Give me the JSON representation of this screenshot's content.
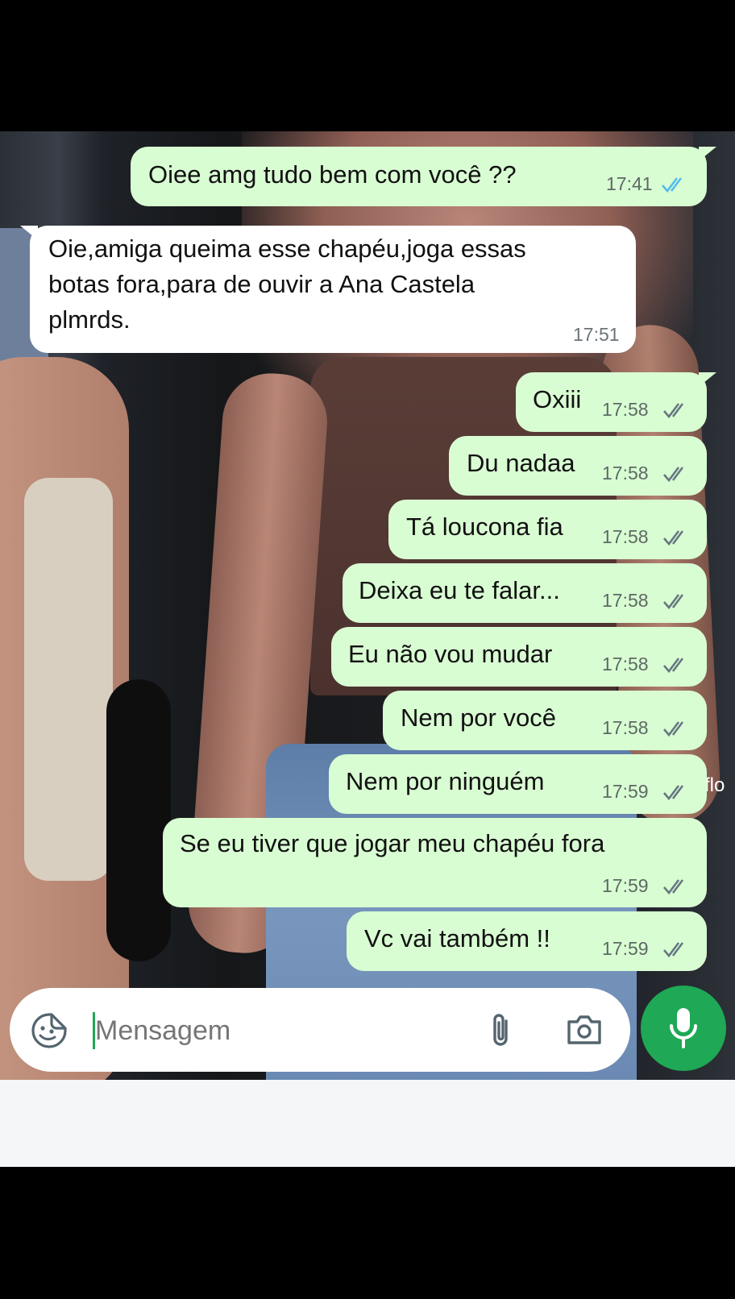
{
  "messages": [
    {
      "dir": "out",
      "text": "Oiee amg tudo bem com você ??",
      "time": "17:41",
      "ticks": "read"
    },
    {
      "dir": "in",
      "text": "Oie,amiga queima esse chapéu,joga essas\nbotas fora,para de ouvir a Ana Castela\nplmrds.",
      "time": "17:51"
    },
    {
      "dir": "out",
      "text": "Oxiii",
      "time": "17:58",
      "ticks": "delivered"
    },
    {
      "dir": "out",
      "text": "Du nadaa",
      "time": "17:58",
      "ticks": "delivered"
    },
    {
      "dir": "out",
      "text": "Tá loucona fia",
      "time": "17:58",
      "ticks": "delivered"
    },
    {
      "dir": "out",
      "text": "Deixa eu te falar...",
      "time": "17:58",
      "ticks": "delivered"
    },
    {
      "dir": "out",
      "text": "Eu não vou mudar",
      "time": "17:58",
      "ticks": "delivered"
    },
    {
      "dir": "out",
      "text": "Nem por você",
      "time": "17:58",
      "ticks": "delivered"
    },
    {
      "dir": "out",
      "text": "Nem por ninguém",
      "time": "17:59",
      "ticks": "delivered"
    },
    {
      "dir": "out",
      "text": "Se eu tiver que jogar meu chapéu fora",
      "time": "17:59",
      "ticks": "delivered"
    },
    {
      "dir": "out",
      "text": "Vc vai também !!",
      "time": "17:59",
      "ticks": "delivered"
    }
  ],
  "wallpaper_text": "flo",
  "composer": {
    "placeholder": "Mensagem",
    "emoji_icon": "sticker-emoji-icon",
    "attach_icon": "paperclip-icon",
    "camera_icon": "camera-icon",
    "mic_icon": "microphone-icon"
  },
  "colors": {
    "outgoing_bubble": "#d9fdd3",
    "incoming_bubble": "#ffffff",
    "read_ticks": "#53bdeb",
    "delivered_ticks": "#667781",
    "mic_button": "#1fa855"
  }
}
